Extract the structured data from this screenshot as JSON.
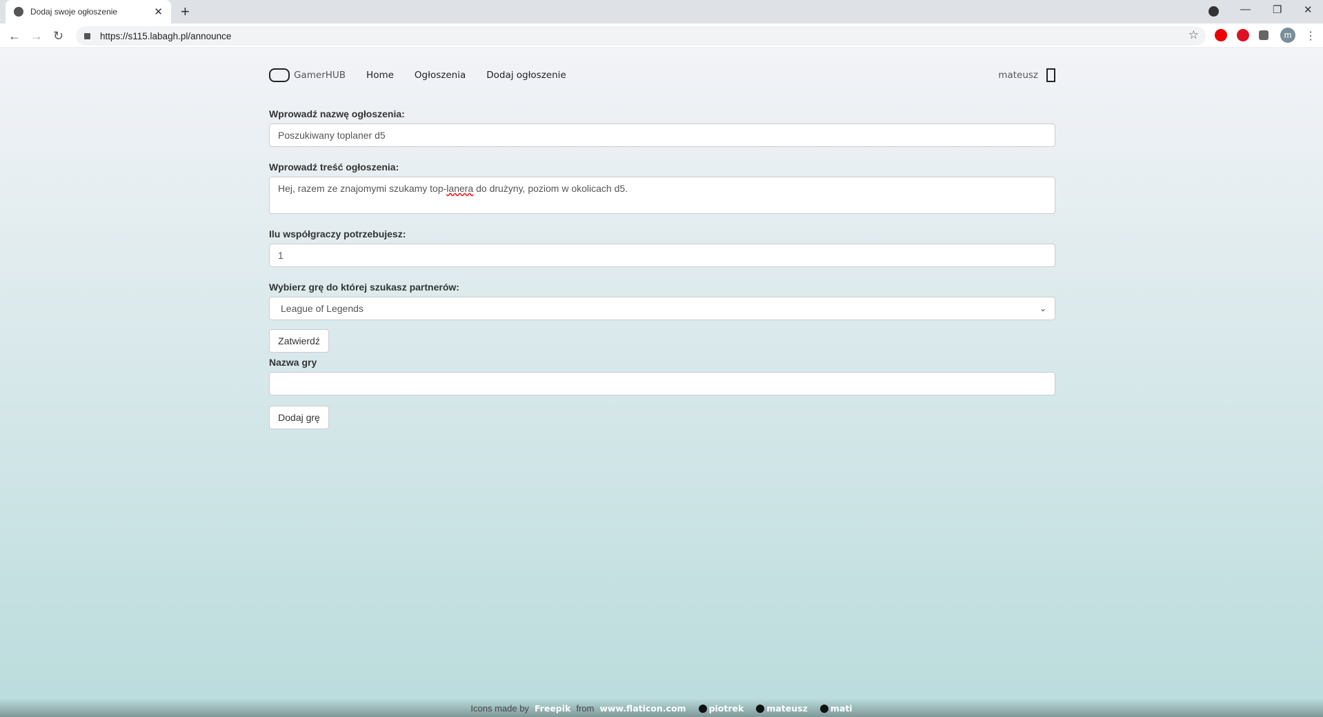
{
  "browser": {
    "tab_title": "Dodaj swoje ogłoszenie",
    "url": "https://s115.labagh.pl/announce",
    "profile_initial": "m"
  },
  "nav": {
    "brand": "GamerHUB",
    "links": [
      "Home",
      "Ogłoszenia",
      "Dodaj ogłoszenie"
    ],
    "user": "mateusz"
  },
  "form": {
    "title_label": "Wprowadź nazwę ogłoszenia:",
    "title_value": "Poszukiwany toplaner d5",
    "content_label": "Wprowadź treść ogłoszenia:",
    "content_pre": "Hej, razem ze znajomymi szukamy top-",
    "content_misspelled": "lanera",
    "content_post": " do drużyny, poziom w okolicach d5.",
    "players_label": "Ilu współgraczy potrzebujesz:",
    "players_value": "1",
    "game_label": "Wybierz grę do której szukasz partnerów:",
    "game_value": "League of Legends",
    "submit": "Zatwierdź",
    "game_name_label": "Nazwa gry",
    "game_name_value": "",
    "add_game": "Dodaj grę"
  },
  "footer": {
    "prefix": "Icons made by",
    "author": "Freepik",
    "from": "from",
    "site": "www.flaticon.com",
    "github": [
      "piotrek",
      "mateusz",
      "mati"
    ]
  }
}
